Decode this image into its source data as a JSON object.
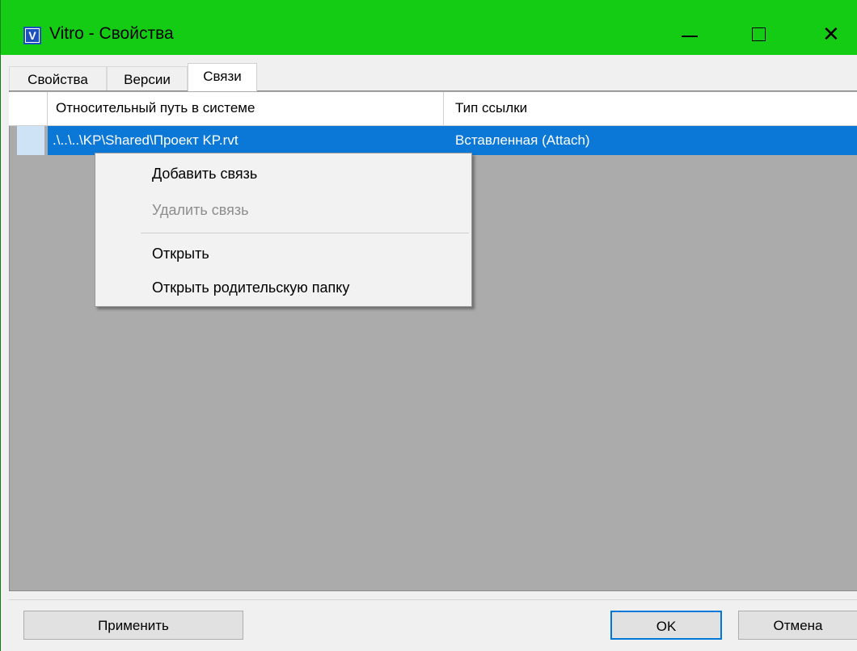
{
  "window": {
    "title": "Vitro - Свойства",
    "app_icon_letter": "V",
    "accent_color": "#14cc14"
  },
  "titlebar_buttons": {
    "minimize_glyph": "—",
    "close_glyph": "✕"
  },
  "tabs": [
    {
      "label": "Свойства",
      "active": false
    },
    {
      "label": "Версии",
      "active": false
    },
    {
      "label": "Связи",
      "active": true
    }
  ],
  "grid": {
    "columns": [
      "Относительный путь в системе",
      "Тип ссылки"
    ],
    "rows": [
      {
        "path": ".\\..\\..\\KP\\Shared\\Проект KP.rvt",
        "link_type": "Вставленная (Attach)",
        "selected": true
      }
    ]
  },
  "context_menu": {
    "items": [
      {
        "label": "Добавить связь",
        "enabled": true
      },
      {
        "label": "Удалить связь",
        "enabled": false
      },
      {
        "label": "Открыть",
        "enabled": true
      },
      {
        "label": "Открыть родительскую папку",
        "enabled": true
      }
    ]
  },
  "footer": {
    "apply_label": "Применить",
    "ok_label": "OK",
    "cancel_label": "Отмена"
  }
}
